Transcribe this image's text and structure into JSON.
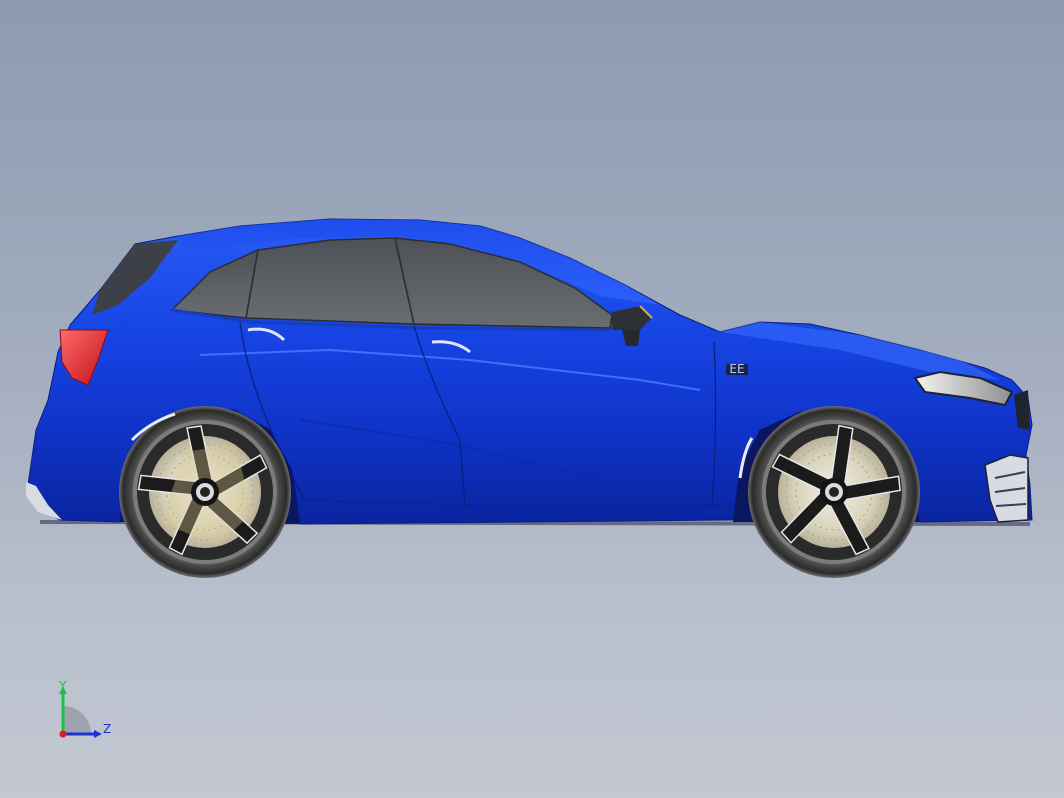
{
  "triad": {
    "y_label": "Y",
    "z_label": "Z",
    "y_color": "#19c34a",
    "z_color": "#1f2fd6",
    "x_color": "#d21e1e"
  },
  "model": {
    "body_color": "#1238d8",
    "glass_color": "#5a5d60",
    "badge": "EE",
    "type": "hatchback-car"
  }
}
